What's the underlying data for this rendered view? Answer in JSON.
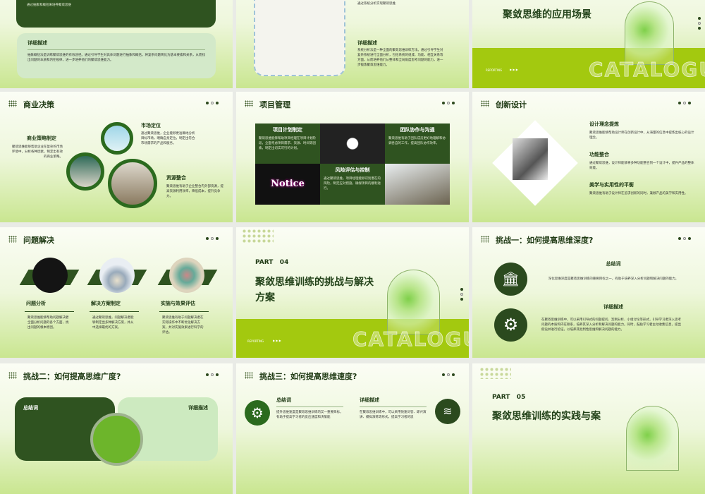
{
  "slides": {
    "s1": {
      "banner_text": "通过抽象和概括来培养聚敛思维",
      "detail_title": "详细描述",
      "detail_text": "抽象概括法是训练聚敛思维的有效途径。通过引导学生对具体问题进行抽象和概括，将复杂问题简化为基本要素和关系，从而找出问题的本质和内在规律，进一步培养他们的聚敛思维能力。"
    },
    "s2": {
      "top_text": "通过系统分析实现聚敛思维",
      "detail_title": "详细描述",
      "detail_text": "系统分析法是一种全面的聚敛思维训练方法。通过引导学生对复杂系统进行全面分析，包括系统的组成、功能、相互关系等方面，从而培养他们从整体和全局角度思考问题的能力，进一步锻炼聚敛思维能力。"
    },
    "s3": {
      "title": "聚敛思维的应用场景",
      "reporting": "REPORTING",
      "arrows": "▶ ▶ ▶",
      "catalogue": "CATALOGUE"
    },
    "s4": {
      "title": "商业决策",
      "items": [
        {
          "title": "商业策略制定",
          "text": "聚敛思维能够帮助企业在复杂的市场环境中，分析各种因素，制定出有效的商业策略。"
        },
        {
          "title": "市场定位",
          "text": "通过聚敛思维，企业能够更准确地分析目标市场，明确自身定位，制定出符合市场需求的产品和服务。"
        },
        {
          "title": "资源整合",
          "text": "聚敛思维有助于企业整合内外部资源，提高资源利用效率，降低成本，提升竞争力。"
        }
      ]
    },
    "s5": {
      "title": "项目管理",
      "image_label": "Notice",
      "items": [
        {
          "title": "项目计划制定",
          "text": "聚敛思维能够帮助项目经理在项目计划阶段，全面考虑项目需求、资源、时间等因素，制定出切实可行的计划。"
        },
        {
          "title": "团队协作与沟通",
          "text": "聚敛思维有助于团队成员更好地理解和协调各自的工作，提高团队协作效率。"
        },
        {
          "title": "风险评估与控制",
          "text": "通过聚敛思维，项目经理能够识别潜在的风险，制定应对措施，确保项目的顺利进行。"
        }
      ]
    },
    "s6": {
      "title": "创新设计",
      "items": [
        {
          "title": "设计理念提炼",
          "text": "聚敛思维能够帮助设计师在创新设计中，从海量的信息中提炼出核心的设计理念。"
        },
        {
          "title": "功能整合",
          "text": "通过聚敛思维，设计师能够将多种功能整合到一个设计中，提升产品的整体效能。"
        },
        {
          "title": "美学与实用性的平衡",
          "text": "聚敛思维有助于设计师在追求创新的同时，兼顾产品的美学和实用性。"
        }
      ]
    },
    "s7": {
      "title": "问题解决",
      "items": [
        {
          "title": "问题分析",
          "text": "聚敛思维能够帮助问题解决者全面分析问题的各个方面，找出问题的根本原因。"
        },
        {
          "title": "解决方案制定",
          "text": "通过聚敛思维，问题解决者能够制定出多种解决方案，并从中选择最优的方案。"
        },
        {
          "title": "实施与效果评估",
          "text": "聚敛思维有助于问题解决者在实际操作中不断优化解决方案，并对实施效果进行科学的评估。"
        }
      ]
    },
    "s8": {
      "part": "PART   04",
      "title": "聚敛思维训练的挑战与解决方案",
      "reporting": "REPORTING",
      "arrows": "▶ ▶ ▶",
      "catalogue": "CATALOGUE"
    },
    "s9": {
      "title": "挑战一：如何提高思维深度?",
      "summary_title": "总结词",
      "summary_text": "深化思维深度是聚敛思维训练的重要目标之一，有助于培养深入分析问题和解决问题的能力。",
      "detail_title": "详细描述",
      "detail_text": "在聚敛思维训练中，可以采用引导式的问题提问、案例分析、小组讨论等形式，引导学习者深入思考问题的本质和内在联系，培养其深入分析和解决问题的能力。同时，鼓励学习者主动收集信息，提出假设并进行验证，以培养其批判性思维和解决问题的能力。"
    },
    "s10": {
      "title": "挑战二：如何提高思维广度?",
      "summary_title": "总结词",
      "detail_title": "详细描述"
    },
    "s11": {
      "title": "挑战三：如何提高思维速度?",
      "summary_title": "总结词",
      "summary_text": "提升思维速度是聚敛思维训练的又一重要目标，有助于提高学习者的反应速度和决策能",
      "detail_title": "详细描述",
      "detail_text": "在聚敛思维训练中，可以采用快速问答、即兴演讲、模拟演练等形式，提高学习者的思"
    },
    "s12": {
      "part": "PART   05",
      "title": "聚敛思维训练的实践与案"
    }
  },
  "colors": {
    "dark_green": "#2f5320",
    "lime": "#a3c90f",
    "light_green": "#cfe8c4"
  }
}
